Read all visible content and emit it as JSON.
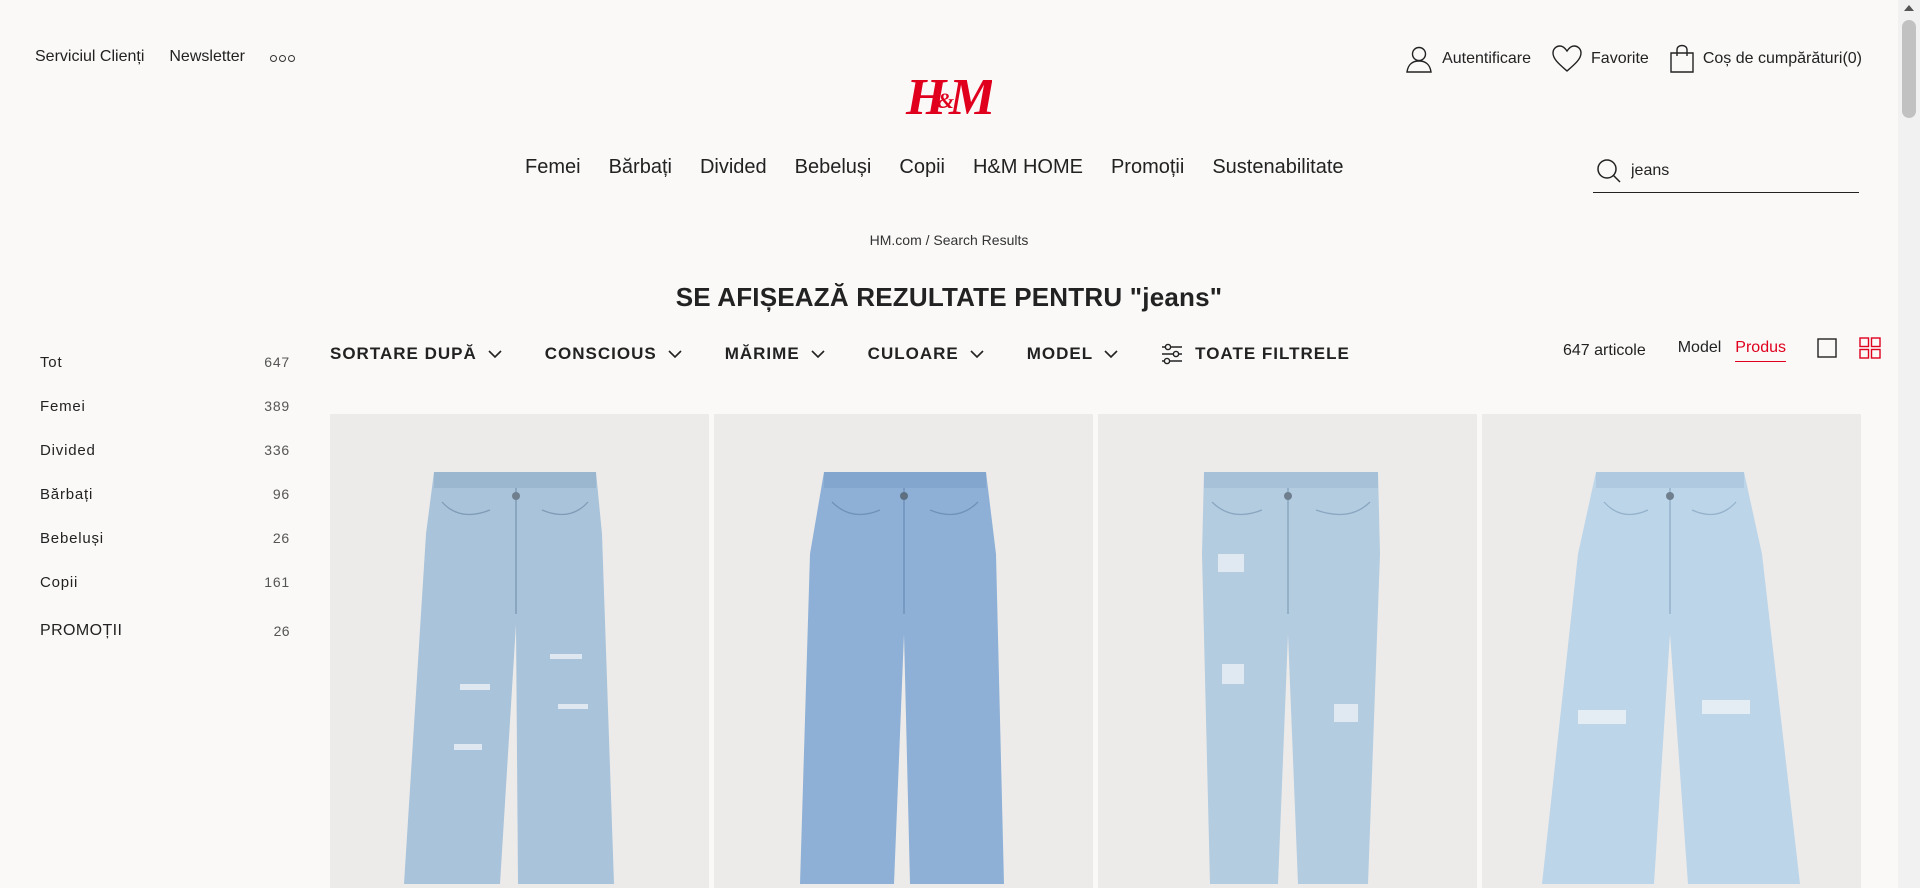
{
  "topbar": {
    "customer_service": "Serviciul Clienți",
    "newsletter": "Newsletter",
    "login": "Autentificare",
    "favorites": "Favorite",
    "cart": "Coș de cumpărături(0)"
  },
  "logo": {
    "text": "H&M",
    "color": "#e0001e"
  },
  "nav": {
    "items": [
      "Femei",
      "Bărbați",
      "Divided",
      "Bebeluși",
      "Copii",
      "H&M HOME",
      "Promoții",
      "Sustenabilitate"
    ]
  },
  "search": {
    "value": "jeans",
    "icon": "search-icon"
  },
  "breadcrumb": {
    "home": "HM.com",
    "separator": " / ",
    "current": "Search Results"
  },
  "title": "SE AFIȘEAZĂ REZULTATE PENTRU \"jeans\"",
  "sidebar": {
    "items": [
      {
        "label": "Tot",
        "count": "647"
      },
      {
        "label": "Femei",
        "count": "389"
      },
      {
        "label": "Divided",
        "count": "336"
      },
      {
        "label": "Bărbați",
        "count": "96"
      },
      {
        "label": "Bebeluși",
        "count": "26"
      },
      {
        "label": "Copii",
        "count": "161"
      },
      {
        "label": "PROMOȚII",
        "count": "26"
      }
    ]
  },
  "filters": {
    "sort": "SORTARE DUPĂ",
    "conscious": "CONSCIOUS",
    "size": "MĂRIME",
    "color": "CULOARE",
    "model": "MODEL",
    "all": "TOATE FILTRELE"
  },
  "results": {
    "count_label": "647 articole",
    "view_model": "Model",
    "view_product": "Produs"
  },
  "colors": {
    "accent": "#e0001e",
    "background": "#faf9f8",
    "product_bg": "#ecebea"
  },
  "products": [
    {
      "name": "product-1",
      "denim": "#a9c3da"
    },
    {
      "name": "product-2",
      "denim": "#8eb0d6"
    },
    {
      "name": "product-3",
      "denim": "#b3cce0"
    },
    {
      "name": "product-4",
      "denim": "#bdd5e8"
    }
  ]
}
